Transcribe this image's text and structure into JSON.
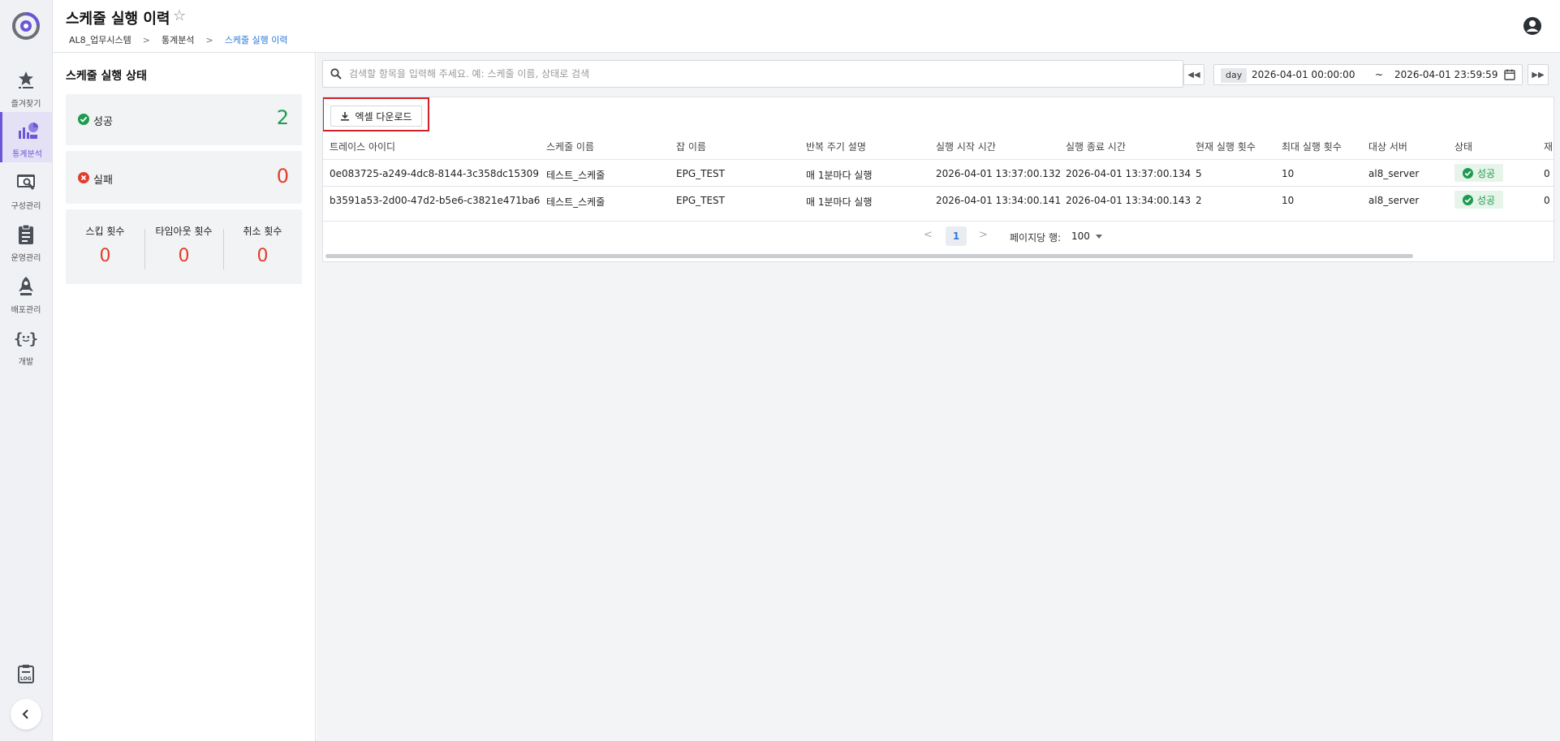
{
  "app": {
    "title": "스케줄 실행 이력"
  },
  "breadcrumb": [
    "AL8_업무시스템",
    "통계분석",
    "스케줄 실행 이력"
  ],
  "nav": {
    "items": [
      {
        "label": "즐겨찾기",
        "icon": "favorites-icon"
      },
      {
        "label": "통계분석",
        "icon": "statistics-icon",
        "active": true
      },
      {
        "label": "구성관리",
        "icon": "configuration-icon"
      },
      {
        "label": "운영관리",
        "icon": "operations-icon"
      },
      {
        "label": "배포관리",
        "icon": "deploy-icon"
      },
      {
        "label": "개발",
        "icon": "develop-icon"
      }
    ]
  },
  "status": {
    "title": "스케줄 실행 상태",
    "success_label": "성공",
    "success_value": "2",
    "fail_label": "실패",
    "fail_value": "0",
    "skip_label": "스킵 횟수",
    "skip_value": "0",
    "timeout_label": "타임아웃 횟수",
    "timeout_value": "0",
    "cancel_label": "취소 횟수",
    "cancel_value": "0"
  },
  "search": {
    "placeholder": "검색할 항목을 입력해 주세요. 예: 스케줄 이름, 상태로 검색",
    "value": ""
  },
  "date": {
    "unit": "day",
    "start": "2026-04-01 00:00:00",
    "tilde": "~",
    "end": "2026-04-01 23:59:59"
  },
  "toolbar": {
    "excel_label": "엑셀 다운로드"
  },
  "table": {
    "headers": [
      "트레이스 아이디",
      "스케줄 이름",
      "잡 이름",
      "반복 주기 설명",
      "실행 시작 시간",
      "실행 종료 시간",
      "현재 실행 횟수",
      "최대 실행 횟수",
      "대상 서버",
      "상태",
      "재"
    ],
    "rows": [
      [
        "0e083725-a249-4dc8-8144-3c358dc15309",
        "테스트_스케줄",
        "EPG_TEST",
        "매 1분마다 실행",
        "2026-04-01 13:37:00.132",
        "2026-04-01 13:37:00.134",
        "5",
        "10",
        "al8_server",
        "성공",
        "0"
      ],
      [
        "b3591a53-2d00-47d2-b5e6-c3821e471ba6",
        "테스트_스케줄",
        "EPG_TEST",
        "매 1분마다 실행",
        "2026-04-01 13:34:00.141",
        "2026-04-01 13:34:00.143",
        "2",
        "10",
        "al8_server",
        "성공",
        "0"
      ]
    ]
  },
  "pagination": {
    "current_page": "1",
    "rows_label": "페이지당 행:",
    "rows_per_page": "100"
  },
  "colors": {
    "accent": "#6b57d6",
    "success": "#1e9b4f",
    "fail": "#e23d2d",
    "link": "#2d7ad6",
    "highlight": "#d0202a"
  }
}
